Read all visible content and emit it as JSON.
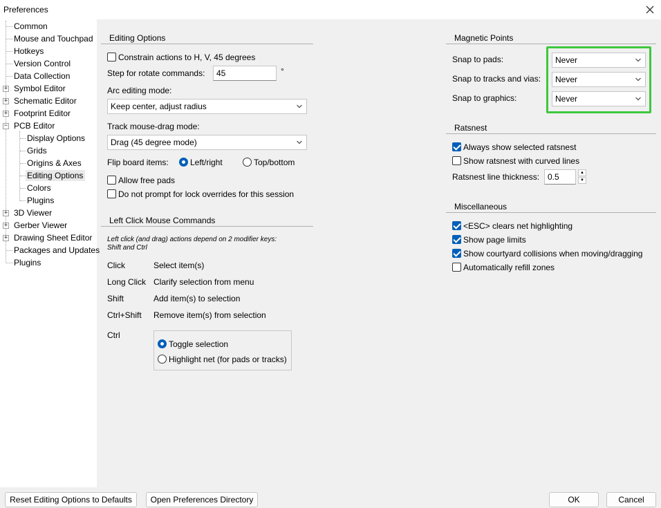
{
  "window": {
    "title": "Preferences"
  },
  "sidebar": {
    "items": [
      {
        "label": "Common"
      },
      {
        "label": "Mouse and Touchpad"
      },
      {
        "label": "Hotkeys"
      },
      {
        "label": "Version Control"
      },
      {
        "label": "Data Collection"
      },
      {
        "label": "Symbol Editor"
      },
      {
        "label": "Schematic Editor"
      },
      {
        "label": "Footprint Editor"
      },
      {
        "label": "PCB Editor"
      },
      {
        "label": "Display Options"
      },
      {
        "label": "Grids"
      },
      {
        "label": "Origins & Axes"
      },
      {
        "label": "Editing Options"
      },
      {
        "label": "Colors"
      },
      {
        "label": "Plugins"
      },
      {
        "label": "3D Viewer"
      },
      {
        "label": "Gerber Viewer"
      },
      {
        "label": "Drawing Sheet Editor"
      },
      {
        "label": "Packages and Updates"
      },
      {
        "label": "Plugins"
      }
    ]
  },
  "editing": {
    "title": "Editing Options",
    "constrain_label": "Constrain actions to H, V, 45 degrees",
    "constrain_checked": false,
    "rotate_label": "Step for rotate commands:",
    "rotate_value": "45",
    "rotate_unit": "°",
    "arc_label": "Arc editing mode:",
    "arc_value": "Keep center, adjust radius",
    "track_label": "Track mouse-drag mode:",
    "track_value": "Drag (45 degree mode)",
    "flip_label": "Flip board items:",
    "flip_lr": "Left/right",
    "flip_tb": "Top/bottom",
    "flip_selected": "Left/right",
    "free_pads_label": "Allow free pads",
    "lock_prompt_label": "Do not prompt for lock overrides for this session"
  },
  "leftclick": {
    "title": "Left Click Mouse Commands",
    "note_line1": "Left click (and drag) actions depend on 2 modifier keys:",
    "note_line2": "Shift and Ctrl",
    "rows": [
      {
        "key": "Click",
        "action": "Select item(s)"
      },
      {
        "key": "Long Click",
        "action": "Clarify selection from menu"
      },
      {
        "key": "Shift",
        "action": "Add item(s) to selection"
      },
      {
        "key": "Ctrl+Shift",
        "action": "Remove item(s) from selection"
      }
    ],
    "ctrl_label": "Ctrl",
    "ctrl_toggle": "Toggle selection",
    "ctrl_highlight": "Highlight net (for pads or tracks)",
    "ctrl_selected": "Toggle selection"
  },
  "magnetic": {
    "title": "Magnetic Points",
    "pads_label": "Snap to pads:",
    "pads_value": "Never",
    "tracks_label": "Snap to tracks and vias:",
    "tracks_value": "Never",
    "graphics_label": "Snap to graphics:",
    "graphics_value": "Never",
    "highlight_color": "#3ec83e"
  },
  "ratsnest": {
    "title": "Ratsnest",
    "always_show_label": "Always show selected ratsnest",
    "always_show_checked": true,
    "curved_label": "Show ratsnest with curved lines",
    "curved_checked": false,
    "thickness_label": "Ratsnest line thickness:",
    "thickness_value": "0.5"
  },
  "misc": {
    "title": "Miscellaneous",
    "esc_label": "<ESC> clears net highlighting",
    "esc_checked": true,
    "page_limits_label": "Show page limits",
    "page_limits_checked": true,
    "courtyard_label": "Show courtyard collisions when moving/dragging",
    "courtyard_checked": true,
    "refill_label": "Automatically refill zones",
    "refill_checked": false
  },
  "footer": {
    "reset_label": "Reset Editing Options to Defaults",
    "open_dir_label": "Open Preferences Directory",
    "ok_label": "OK",
    "cancel_label": "Cancel"
  },
  "colors": {
    "accent": "#005fb8"
  }
}
